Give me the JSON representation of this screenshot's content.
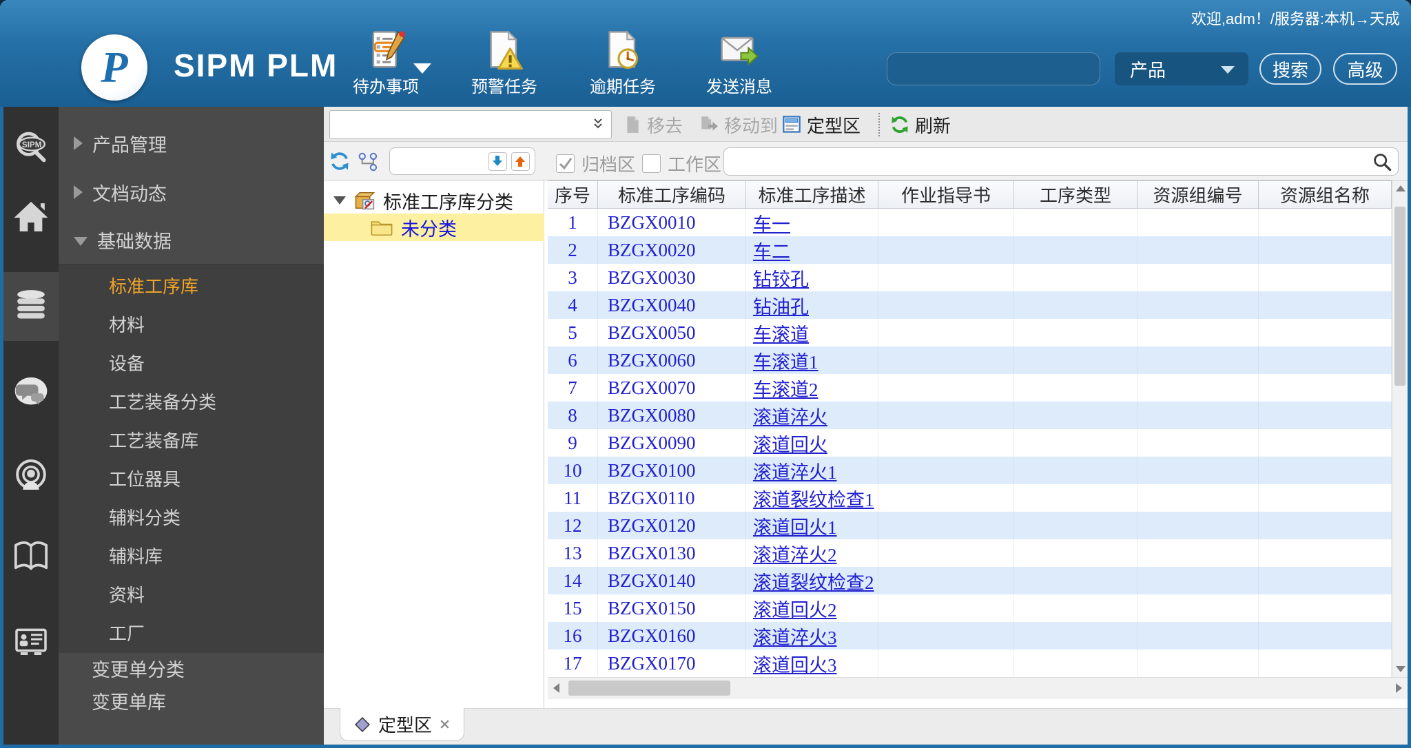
{
  "window": {
    "welcome": "欢迎,adm！/服务器:本机→天成",
    "brand": "SIPM PLM"
  },
  "header": {
    "quick_actions": [
      {
        "icon": "todo-list-icon",
        "label": "待办事项"
      },
      {
        "icon": "warning-task-icon",
        "label": "预警任务"
      },
      {
        "icon": "overdue-task-icon",
        "label": "逾期任务"
      },
      {
        "icon": "send-message-icon",
        "label": "发送消息"
      }
    ],
    "search": {
      "value": "",
      "category": "产品",
      "search_button": "搜索",
      "advanced_button": "高级"
    }
  },
  "rail": {
    "icons": [
      "sipm-search-icon",
      "home-icon",
      "database-icon",
      "chat-icon",
      "contact-broadcast-icon",
      "book-icon",
      "id-card-icon"
    ],
    "active": "database-icon"
  },
  "nav": {
    "items_top": [
      "产品管理",
      "文档动态",
      "基础数据"
    ],
    "items_sub": [
      "标准工序库",
      "材料",
      "设备",
      "工艺装备分类",
      "工艺装备库",
      "工位器具",
      "辅料分类",
      "辅料库",
      "资料",
      "工厂"
    ],
    "active_sub": "标准工序库",
    "items_bottom": [
      "变更单分类",
      "变更单库"
    ]
  },
  "toolbar": {
    "remove": "移去",
    "move_to": "移动到",
    "archive_zone": "定型区",
    "refresh": "刷新"
  },
  "filterbar": {
    "archive_label": "归档区",
    "archive_checked": true,
    "workspace_label": "工作区",
    "workspace_checked": false,
    "search_value": ""
  },
  "tree": {
    "root": "标准工序库分类",
    "selected_child": "未分类"
  },
  "table": {
    "columns": [
      "序号",
      "标准工序编码",
      "标准工序描述",
      "作业指导书",
      "工序类型",
      "资源组编号",
      "资源组名称"
    ],
    "rows": [
      {
        "index": "1",
        "code": "BZGX0010",
        "desc": "车一"
      },
      {
        "index": "2",
        "code": "BZGX0020",
        "desc": "车二"
      },
      {
        "index": "3",
        "code": "BZGX0030",
        "desc": "钻铰孔"
      },
      {
        "index": "4",
        "code": "BZGX0040",
        "desc": "钻油孔"
      },
      {
        "index": "5",
        "code": "BZGX0050",
        "desc": "车滚道"
      },
      {
        "index": "6",
        "code": "BZGX0060",
        "desc": "车滚道1"
      },
      {
        "index": "7",
        "code": "BZGX0070",
        "desc": "车滚道2"
      },
      {
        "index": "8",
        "code": "BZGX0080",
        "desc": "滚道淬火"
      },
      {
        "index": "9",
        "code": "BZGX0090",
        "desc": "滚道回火"
      },
      {
        "index": "10",
        "code": "BZGX0100",
        "desc": "滚道淬火1"
      },
      {
        "index": "11",
        "code": "BZGX0110",
        "desc": "滚道裂纹检查1"
      },
      {
        "index": "12",
        "code": "BZGX0120",
        "desc": "滚道回火1"
      },
      {
        "index": "13",
        "code": "BZGX0130",
        "desc": "滚道淬火2"
      },
      {
        "index": "14",
        "code": "BZGX0140",
        "desc": "滚道裂纹检查2"
      },
      {
        "index": "15",
        "code": "BZGX0150",
        "desc": "滚道回火2"
      },
      {
        "index": "16",
        "code": "BZGX0160",
        "desc": "滚道淬火3"
      },
      {
        "index": "17",
        "code": "BZGX0170",
        "desc": "滚道回火3"
      }
    ]
  },
  "tabs": {
    "active": "定型区"
  },
  "colors": {
    "header_blue": "#2470a7",
    "window_border_blue": "#1f6da5",
    "nav_bg": "#4a4a4a",
    "nav_active_orange": "#eea32a",
    "tree_selection_yellow": "#fdf0a0",
    "link_blue": "#2121cf",
    "row_alt_blue": "#ddebfb",
    "refresh_green": "#2fa32f",
    "up_arrow_orange": "#e8650d",
    "down_arrow_blue": "#1e8bc3"
  }
}
